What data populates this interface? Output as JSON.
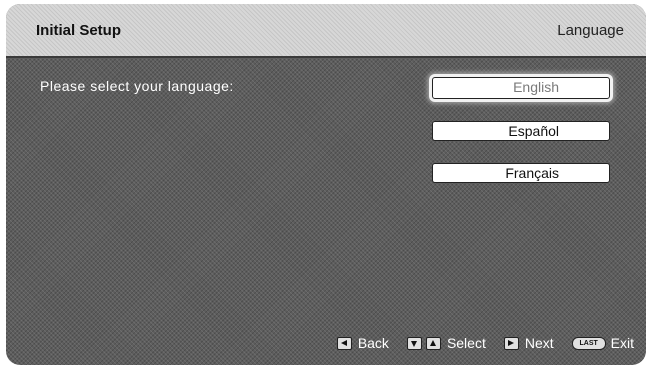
{
  "header": {
    "title": "Initial Setup",
    "section": "Language"
  },
  "prompt": "Please select your language:",
  "languages": [
    {
      "label": "English",
      "selected": true
    },
    {
      "label": "Español",
      "selected": false
    },
    {
      "label": "Français",
      "selected": false
    }
  ],
  "footer": {
    "back_icon": "left-arrow-key-icon",
    "back_label": "Back",
    "select_icons": [
      "down-arrow-key-icon",
      "up-arrow-key-icon"
    ],
    "select_label": "Select",
    "next_icon": "right-arrow-key-icon",
    "next_label": "Next",
    "exit_key_text": "LAST",
    "exit_label": "Exit"
  },
  "colors": {
    "background": "#5d5d5d",
    "header_background": "#d7d7d7",
    "text_light": "#ffffff",
    "selected_text": "#7a7a7a"
  }
}
